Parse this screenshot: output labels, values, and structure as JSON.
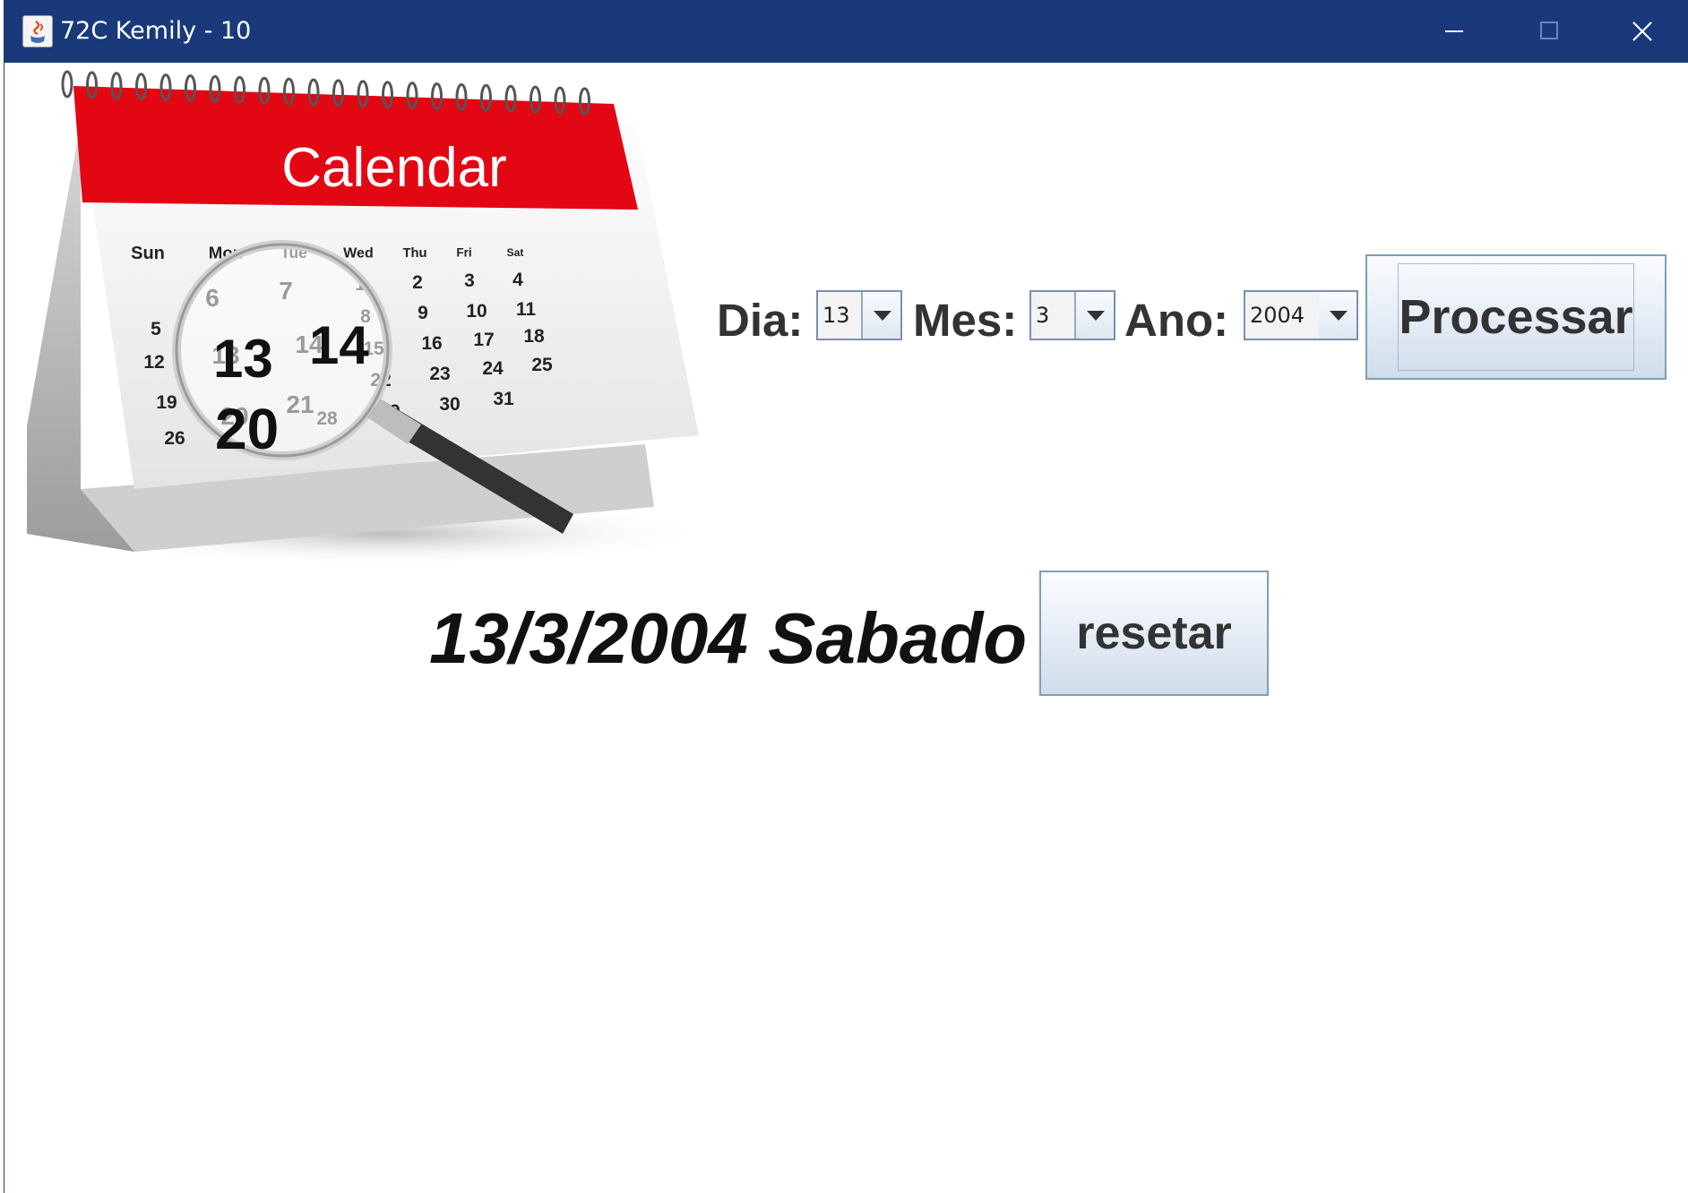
{
  "window": {
    "title": "72C Kemily - 10",
    "controls": {
      "minimize": "minimize-icon",
      "maximize": "maximize-icon",
      "close": "close-icon"
    },
    "titlebar_color": "#19397a"
  },
  "calendar_image": {
    "header_color": "#e30613",
    "brand": "Calendar",
    "weekdays": [
      "Sun",
      "Mon",
      "Tue",
      "Wed",
      "Thu",
      "Fri",
      "Sat"
    ],
    "numbers": [
      "1",
      "2",
      "3",
      "4",
      "5",
      "6",
      "7",
      "8",
      "9",
      "10",
      "11",
      "12",
      "13",
      "14",
      "15",
      "16",
      "17",
      "18",
      "19",
      "20",
      "21",
      "22",
      "23",
      "24",
      "25",
      "26",
      "28",
      "29",
      "30",
      "31"
    ]
  },
  "form": {
    "dia_label": "Dia:",
    "dia_value": "13",
    "mes_label": "Mes:",
    "mes_value": "3",
    "ano_label": "Ano:",
    "ano_value": "2004",
    "process_button": "Processar"
  },
  "result": {
    "text": "13/3/2004 Sabado",
    "reset_button": "resetar"
  }
}
